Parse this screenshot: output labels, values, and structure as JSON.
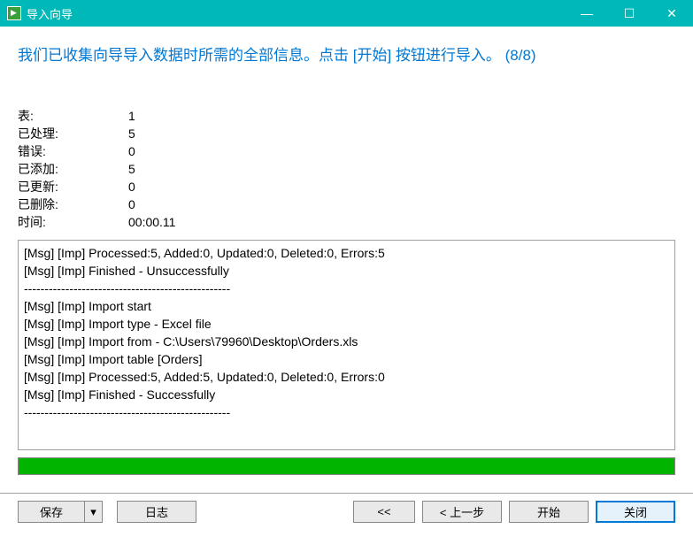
{
  "titlebar": {
    "title": "导入向导"
  },
  "heading": "我们已收集向导导入数据时所需的全部信息。点击 [开始] 按钮进行导入。  (8/8)",
  "stats": [
    {
      "label": "表:",
      "value": "1"
    },
    {
      "label": "已处理:",
      "value": "5"
    },
    {
      "label": "错误:",
      "value": "0"
    },
    {
      "label": "已添加:",
      "value": "5"
    },
    {
      "label": "已更新:",
      "value": "0"
    },
    {
      "label": "已删除:",
      "value": "0"
    },
    {
      "label": "时间:",
      "value": "00:00.11"
    }
  ],
  "log": [
    "[Msg] [Imp] Processed:5, Added:0, Updated:0, Deleted:0, Errors:5",
    "[Msg] [Imp] Finished - Unsuccessfully",
    "--------------------------------------------------",
    "[Msg] [Imp] Import start",
    "[Msg] [Imp] Import type - Excel file",
    "[Msg] [Imp] Import from - C:\\Users\\79960\\Desktop\\Orders.xls",
    "[Msg] [Imp] Import table [Orders]",
    "[Msg] [Imp] Processed:5, Added:5, Updated:0, Deleted:0, Errors:0",
    "[Msg] [Imp] Finished - Successfully",
    "--------------------------------------------------"
  ],
  "buttons": {
    "save": "保存",
    "dropdown": "▾",
    "log": "日志",
    "first": "<<",
    "prev": "< 上一步",
    "start": "开始",
    "close": "关闭"
  },
  "controls": {
    "minimize": "—",
    "maximize": "☐",
    "close": "✕"
  }
}
